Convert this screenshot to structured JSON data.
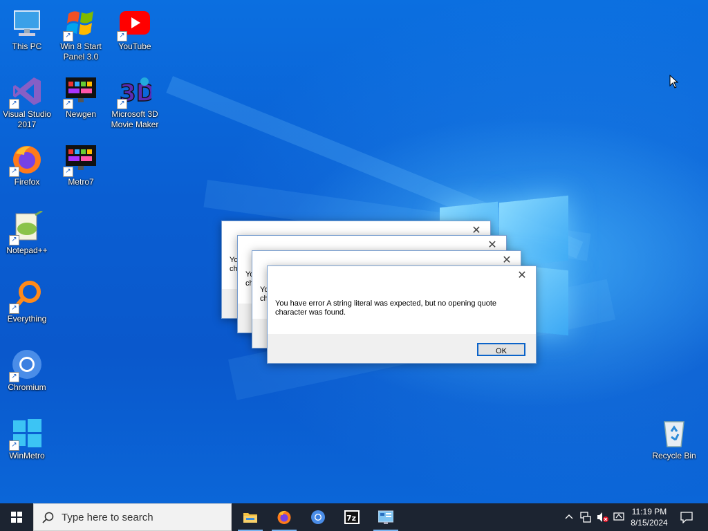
{
  "desktop_icons": [
    {
      "label": "This PC"
    },
    {
      "label": "Win 8 Start Panel 3.0"
    },
    {
      "label": "YouTube"
    },
    {
      "label": "Visual Studio 2017"
    },
    {
      "label": "Newgen"
    },
    {
      "label": "Microsoft 3D Movie Maker"
    },
    {
      "label": "Firefox"
    },
    {
      "label": "Metro7"
    },
    {
      "label": "Notepad++"
    },
    {
      "label": "Everything"
    },
    {
      "label": "Chromium"
    },
    {
      "label": "WinMetro"
    },
    {
      "label": "Recycle Bin"
    }
  ],
  "dialogs": {
    "stack_partial_text": [
      "Yo",
      "ch"
    ],
    "front": {
      "message": "You have error A string literal was expected, but no opening quote character was found.",
      "ok_label": "OK"
    }
  },
  "taskbar": {
    "search_placeholder": "Type here to search",
    "pinned": [
      "file-explorer-icon",
      "firefox-icon",
      "chromium-icon",
      "7zip-icon",
      "control-panel-icon"
    ],
    "time": "11:19 PM",
    "date": "8/15/2024"
  },
  "colors": {
    "desktop_blue": "#0a5ed2",
    "taskbar": "#1c2431",
    "accent": "#0b63c9"
  }
}
